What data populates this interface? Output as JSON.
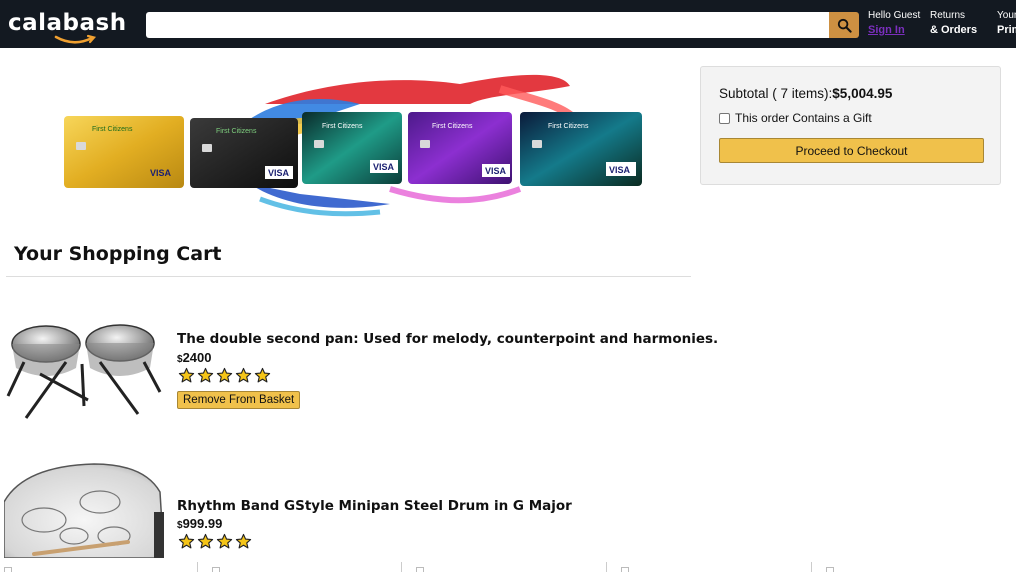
{
  "header": {
    "logo_text": "calabash",
    "search_placeholder": "",
    "signin_greeting": "Hello Guest",
    "signin_label": "Sign In",
    "returns_line1": "Returns",
    "returns_line2": "& Orders",
    "prime_line1": "Your",
    "prime_line2": "Prime"
  },
  "banner": {
    "card_brand": "First Citizens",
    "card_network": "VISA"
  },
  "subtotal": {
    "prefix": "Subtotal ( 7 items):",
    "amount": "$5,004.95",
    "gift_label": "This order Contains a Gift",
    "checkout_label": "Proceed to Checkout"
  },
  "cart": {
    "title": "Your Shopping Cart",
    "items": [
      {
        "title": "The double second pan: Used for melody, counterpoint and harmonies.",
        "currency": "$",
        "price": "2400",
        "rating": 5,
        "remove_label": "Remove From Basket"
      },
      {
        "title": "Rhythm Band GStyle Minipan Steel Drum in G Major",
        "currency": "$",
        "price": "999.99",
        "rating": 4
      }
    ]
  },
  "colors": {
    "header_bg": "#131921",
    "search_button": "#cd9042",
    "accent_button": "#f0c14b",
    "signin_link": "#7b2fbe"
  }
}
